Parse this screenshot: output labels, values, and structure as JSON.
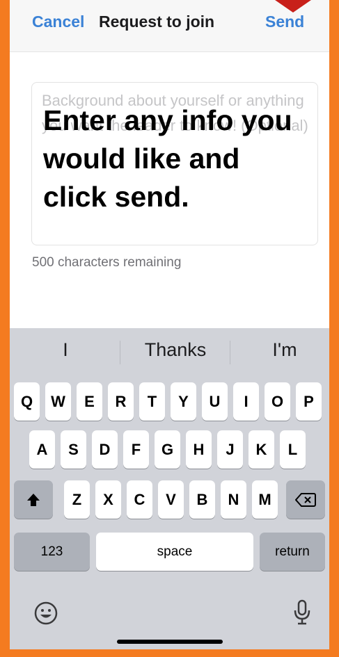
{
  "nav": {
    "cancel": "Cancel",
    "title": "Request to join",
    "send": "Send"
  },
  "form": {
    "placeholder": "Background about yourself or anything you want the leader to know! (Optional)",
    "overlay": "Enter any info you would like and click send.",
    "remaining": "500 characters remaining"
  },
  "keyboard": {
    "suggestions": [
      "I",
      "Thanks",
      "I'm"
    ],
    "row1": [
      "Q",
      "W",
      "E",
      "R",
      "T",
      "Y",
      "U",
      "I",
      "O",
      "P"
    ],
    "row2": [
      "A",
      "S",
      "D",
      "F",
      "G",
      "H",
      "J",
      "K",
      "L"
    ],
    "row3": [
      "Z",
      "X",
      "C",
      "V",
      "B",
      "N",
      "M"
    ],
    "numbers": "123",
    "space": "space",
    "return": "return"
  },
  "colors": {
    "accent": "#3b82d6",
    "frame": "#f47b20",
    "arrow": "#c8201a"
  },
  "icons": [
    "shift-icon",
    "backspace-icon",
    "emoji-icon",
    "microphone-icon"
  ]
}
